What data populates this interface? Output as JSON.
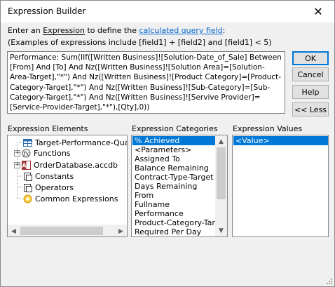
{
  "window": {
    "title": "Expression Builder",
    "close_glyph": "✕"
  },
  "intro": {
    "prefix": "Enter an ",
    "expression_word": "Expression",
    "middle": " to define the ",
    "link": "calculated query field",
    "suffix": ":"
  },
  "examples_text": "(Examples of expressions include [field1] + [field2] and [field1] < 5)",
  "expression_text": "Performance: Sum(IIf([Written Business]![Solution-Date_of_Sale] Between [From] And [To] And Nz([Written Business]![Solution Area]=[Solution-Area-Target],\"*\") And Nz([Written Business]![Product Category]=[Product-Category-Target],\"*\") And Nz([Written Business]![Sub-Category]=[Sub-Category-Target],\"*\") And Nz([Written Business]![Servive Provider]=[Service-Provider-Target],\"*\"),[Qty],0))",
  "buttons": {
    "ok": "OK",
    "cancel": "Cancel",
    "help": "Help",
    "less": "<< Less"
  },
  "elements": {
    "label": "Expression Elements",
    "items": [
      {
        "label": "Target-Performance-Quan",
        "icon": "query-icon"
      },
      {
        "label": "Functions",
        "icon": "function-icon"
      },
      {
        "label": "OrderDatabase.accdb",
        "icon": "database-icon"
      },
      {
        "label": "Constants",
        "icon": "constants-icon"
      },
      {
        "label": "Operators",
        "icon": "operators-icon"
      },
      {
        "label": "Common Expressions",
        "icon": "common-expressions-icon"
      }
    ]
  },
  "categories": {
    "label": "Expression Categories",
    "items": [
      "% Achieved",
      "<Parameters>",
      "Assigned To",
      "Balance Remaining",
      "Contract-Type-Target",
      "Days Remaining",
      "From",
      "Fullname",
      "Performance",
      "Product-Category-Targe",
      "Required Per Day"
    ],
    "selected_index": 0
  },
  "values": {
    "label": "Expression Values",
    "items": [
      "<Value>"
    ],
    "selected_index": 0
  },
  "colors": {
    "accent": "#0078d7",
    "link": "#0066cc"
  }
}
